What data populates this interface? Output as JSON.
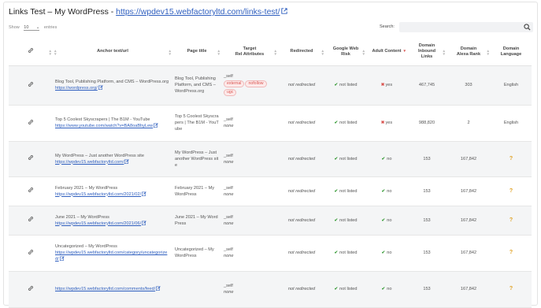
{
  "title": {
    "prefix": "Links Test – My WordPress - ",
    "link": "https://wpdev15.webfactoryltd.com/links-test/"
  },
  "toolbar": {
    "show_label": "Show",
    "show_value": "10",
    "entries_label": "entries",
    "search_label": "Search:"
  },
  "columns": {
    "anchor": "Anchor text/url",
    "page_title": "Page title",
    "target_1": "Target",
    "target_2": "Rel Attributes",
    "redirected": "Redirected",
    "google_1": "Google Web",
    "google_2": "Risk",
    "adult": "Adult Content",
    "inbound_1": "Domain",
    "inbound_2": "Inbound",
    "inbound_3": "Links",
    "alexa_1": "Domain",
    "alexa_2": "Alexa Rank",
    "lang_1": "Domain",
    "lang_2": "Language"
  },
  "rows": [
    {
      "anchor": "Blog Tool, Publishing Platform, and CMS – WordPress.org",
      "url": "https://wordpress.org/",
      "page_title": "Blog Tool, Publishing Platform, and CMS – WordPress.org",
      "target": "_self",
      "rel": [
        "external",
        "nofollow",
        "ugc"
      ],
      "redirected": "not redirected",
      "google": "not listed",
      "adult": "yes",
      "inbound": "467,745",
      "alexa": "303",
      "lang": "English"
    },
    {
      "anchor": "Top 5 Coolest Skyscrapers | The B1M - YouTube",
      "url": "https://www.youtube.com/watch?v=BA8oaBhyLew",
      "page_title": "Top 5 Coolest Skyscrapers | The B1M - YouTube",
      "target": "_self",
      "rel_text": "none",
      "redirected": "not redirected",
      "google": "not listed",
      "adult": "yes",
      "inbound": "988,820",
      "alexa": "2",
      "lang": "English"
    },
    {
      "anchor": "My WordPress – Just another WordPress site",
      "url": "https://wpdev15.webfactoryltd.com/",
      "page_title": "My WordPress – Just another WordPress site",
      "target": "_self",
      "rel_text": "none",
      "redirected": "not redirected",
      "google": "not listed",
      "adult": "no",
      "inbound": "153",
      "alexa": "167,842",
      "lang": "?"
    },
    {
      "anchor": "February 2021 – My WordPress",
      "url": "https://wpdev15.webfactoryltd.com/2021/02/",
      "page_title": "February 2021 – My WordPress",
      "target": "_self",
      "rel_text": "none",
      "redirected": "not redirected",
      "google": "not listed",
      "adult": "no",
      "inbound": "153",
      "alexa": "167,842",
      "lang": "?"
    },
    {
      "anchor": "June 2021 – My WordPress",
      "url": "https://wpdev15.webfactoryltd.com/2021/06/",
      "page_title": "June 2021 – My WordPress",
      "target": "_self",
      "rel_text": "none",
      "redirected": "not redirected",
      "google": "not listed",
      "adult": "no",
      "inbound": "153",
      "alexa": "167,842",
      "lang": "?"
    },
    {
      "anchor": "Uncategorized – My WordPress",
      "url": "https://wpdev15.webfactoryltd.com/category/uncategorized/",
      "page_title": "Uncategorized – My WordPress",
      "target": "_self",
      "rel_text": "none",
      "redirected": "not redirected",
      "google": "not listed",
      "adult": "no",
      "inbound": "153",
      "alexa": "167,842",
      "lang": "?"
    },
    {
      "anchor": "",
      "url": "https://wpdev15.webfactoryltd.com/comments/feed/",
      "page_title": "",
      "target": "_self",
      "rel_text": "none",
      "redirected": "not redirected",
      "google": "not listed",
      "adult": "no",
      "inbound": "153",
      "alexa": "167,842",
      "lang": "?"
    }
  ]
}
